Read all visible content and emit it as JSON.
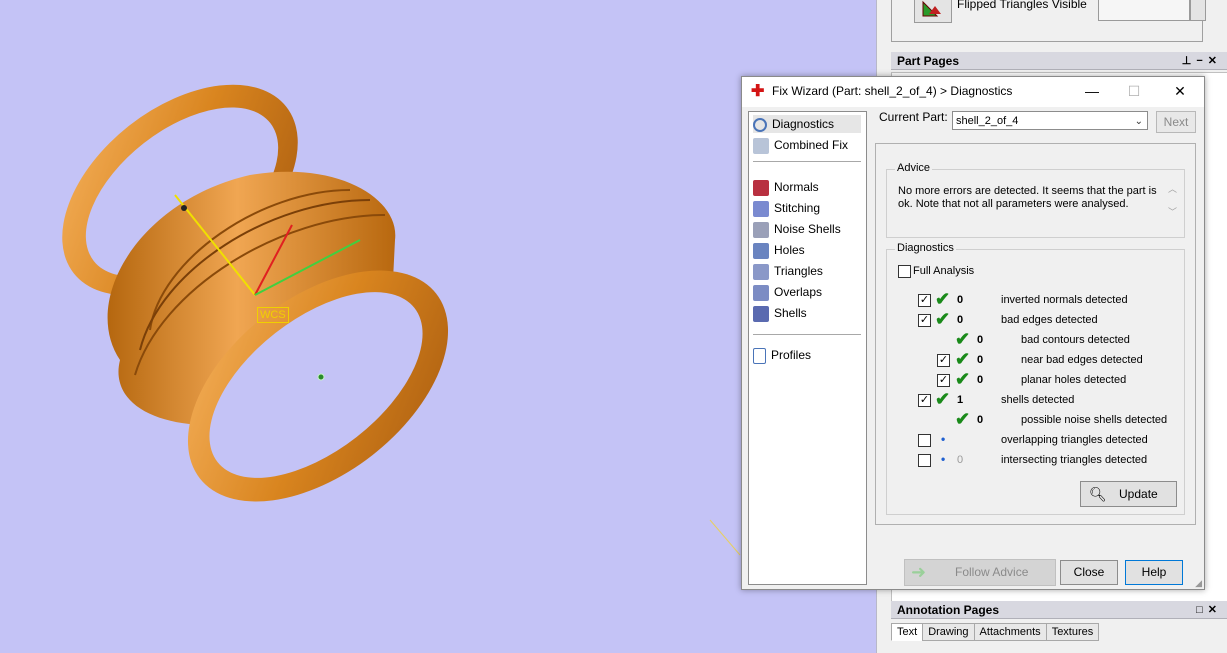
{
  "top_panel": {
    "flip_label": "Flipped Triangles Visible"
  },
  "part_pages": {
    "title": "Part Pages"
  },
  "annotation_pages": {
    "title": "Annotation Pages",
    "tabs": [
      "Text",
      "Drawing",
      "Attachments",
      "Textures"
    ]
  },
  "viewport": {
    "wcs_label": "WCS"
  },
  "dialog": {
    "title": "Fix Wizard (Part: shell_2_of_4) > Diagnostics",
    "minimize": "—",
    "maximize": "☐",
    "close": "✕",
    "nav": {
      "group1": [
        "Diagnostics",
        "Combined Fix"
      ],
      "group2": [
        "Normals",
        "Stitching",
        "Noise Shells",
        "Holes",
        "Triangles",
        "Overlaps",
        "Shells"
      ],
      "group3": [
        "Profiles"
      ]
    },
    "current_part_label": "Current Part:",
    "current_part_value": "shell_2_of_4",
    "next_label": "Next",
    "advice_title": "Advice",
    "advice_text": "No more errors are detected. It seems that the part is ok. Note that not all parameters were analysed.",
    "diagnostics_title": "Diagnostics",
    "full_analysis_label": "Full Analysis",
    "rows": [
      {
        "checked": true,
        "indent": 0,
        "status": "ok",
        "count": "0",
        "label": "inverted normals detected"
      },
      {
        "checked": true,
        "indent": 0,
        "status": "ok",
        "count": "0",
        "label": "bad edges detected"
      },
      {
        "checked": null,
        "indent": 1,
        "status": "ok",
        "count": "0",
        "label": "bad contours detected"
      },
      {
        "checked": true,
        "indent": 1,
        "status": "ok",
        "count": "0",
        "label": "near bad edges detected"
      },
      {
        "checked": true,
        "indent": 1,
        "status": "ok",
        "count": "0",
        "label": "planar holes detected"
      },
      {
        "checked": true,
        "indent": 0,
        "status": "ok",
        "count": "1",
        "label": "shells detected"
      },
      {
        "checked": null,
        "indent": 1,
        "status": "ok",
        "count": "0",
        "label": "possible noise shells detected"
      },
      {
        "checked": false,
        "indent": 0,
        "status": "dot",
        "count": "",
        "label": "overlapping triangles detected"
      },
      {
        "checked": false,
        "indent": 0,
        "status": "dot",
        "count": "0",
        "label": "intersecting triangles detected"
      }
    ],
    "update_label": "Update",
    "follow_advice_label": "Follow Advice",
    "close_label": "Close",
    "help_label": "Help"
  }
}
